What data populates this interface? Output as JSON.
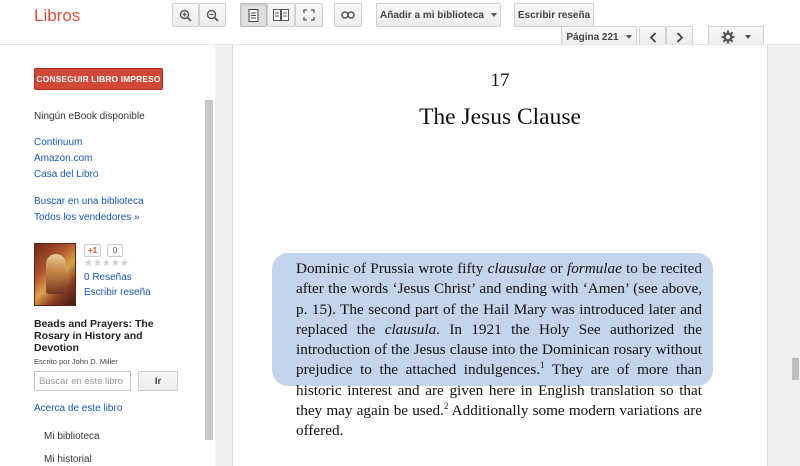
{
  "app": {
    "brand": "Libros"
  },
  "toolbar": {
    "add_to_library": "Añadir a mi biblioteca",
    "write_review": "Escribir reseña",
    "page_selector": "Página 221"
  },
  "sidebar": {
    "buy_button": "CONSEGUIR LIBRO IMPRESO",
    "no_ebook": "Ningún eBook disponible",
    "sellers": [
      "Continuum",
      "Amazon.com",
      "Casa del Libro"
    ],
    "find_library": "Buscar en una biblioteca",
    "all_sellers": "Todos los vendedores »",
    "plus_one": "+1",
    "plus_count": "0",
    "stars": "★★★★★",
    "reviews_link": "0 Reseñas",
    "write_review_link": "Escribir reseña",
    "book_title": "Beads and Prayers: The Rosary in History and Devotion",
    "book_author": "Escrito por John D. Miller",
    "search_placeholder": "Buscar en este libro",
    "search_button": "Ir",
    "about_book": "Acerca de este libro",
    "my_library": "Mi biblioteca",
    "my_history": "Mi historial"
  },
  "page": {
    "chapter_number": "17",
    "chapter_title": "The Jesus Clause",
    "paragraph_parts": [
      "Dominic of Prussia wrote fifty ",
      "clausulae",
      " or ",
      "formulae",
      " to be recited after the words ‘Jesus Christ’ and ending with ‘Amen’ (see above, p. 15). The second part of the Hail Mary was introduced later and replaced the ",
      "clausula",
      ". In 1921 the Holy See authorized the introduction of the Jesus clause into the Dominican rosary without prejudice to the attached indulgences.",
      "1",
      " They are of more than historic interest and are given here in English translation so that they may again be used.",
      "2",
      " Additionally some modern variations are offered."
    ]
  },
  "colors": {
    "brand": "#dd4b39",
    "buy_button": "#d14836",
    "link": "#1a55b8",
    "highlight": "#b8cce8"
  },
  "icons": [
    "zoom-in-icon",
    "zoom-out-icon",
    "single-page-icon",
    "two-page-icon",
    "fullscreen-icon",
    "link-icon",
    "chevron-left-icon",
    "chevron-right-icon",
    "gear-icon"
  ]
}
